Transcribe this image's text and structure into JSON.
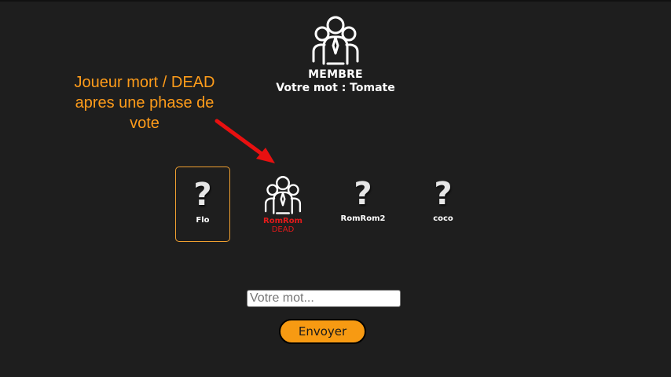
{
  "header": {
    "role_icon": "group-people-icon",
    "role_title": "MEMBRE",
    "word_line": "Votre mot : Tomate"
  },
  "annotation": {
    "lines": [
      "Joueur mort / DEAD",
      "apres une phase de",
      "vote"
    ],
    "color": "#ff9c1a",
    "arrow_color": "#e81010"
  },
  "players": [
    {
      "name": "Flo",
      "avatar": "question-mark-icon",
      "status": "",
      "selected": true
    },
    {
      "name": "RomRom",
      "avatar": "group-people-icon",
      "status": "DEAD",
      "selected": false
    },
    {
      "name": "RomRom2",
      "avatar": "question-mark-icon",
      "status": "",
      "selected": false
    },
    {
      "name": "coco",
      "avatar": "question-mark-icon",
      "status": "",
      "selected": false
    }
  ],
  "form": {
    "input_placeholder": "Votre mot...",
    "input_value": "",
    "send_label": "Envoyer"
  },
  "colors": {
    "background": "#1e1e1e",
    "accent": "#f79a12",
    "dead": "#e11a1a"
  }
}
